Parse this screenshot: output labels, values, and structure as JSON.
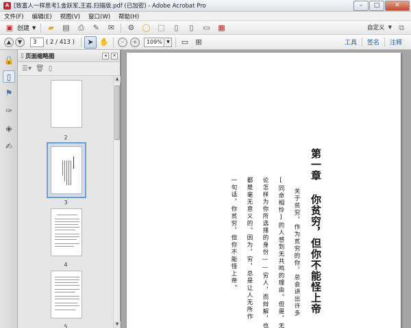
{
  "window": {
    "title": "[致富人一样思考].金跃军,王岩.扫描版.pdf (已加密) - Adobe Acrobat Pro",
    "app_icon": "pdf-app-icon",
    "minimize": "–",
    "maximize": "□",
    "close": "✕"
  },
  "menu": [
    "文件(F)",
    "编辑(E)",
    "视图(V)",
    "窗口(W)",
    "帮助(H)"
  ],
  "toolbar": {
    "create_label": "创建",
    "customize_label": "自定义"
  },
  "nav": {
    "page_input": "3",
    "page_count": "( 2 / 413 )",
    "zoom_value": "109%",
    "links": [
      "工具",
      "签名",
      "注释"
    ]
  },
  "panel": {
    "title": "页面缩略图",
    "thumbnails": [
      {
        "label": "2"
      },
      {
        "label": "3"
      },
      {
        "label": "4"
      },
      {
        "label": "5"
      }
    ]
  },
  "document": {
    "chapter_title": "第一章  你贫穷，但你不能怪上帝",
    "body_columns": [
      "关于贫穷，作为贫穷的你，总会讲出许多",
      "[同命相怜]的人感到无共鸣的理由。但是，无",
      "论怎样为你所选择的身份——穷人，而辩解，也",
      "都是毫无意义的。因为，穷，总是让人无所作",
      "一句话，你贫穷，但你不能怪上帝。"
    ]
  },
  "colors": {
    "link_blue": "#1d5fa8",
    "selection_border": "#6f9ccf",
    "close_red": "#c84a2c"
  }
}
